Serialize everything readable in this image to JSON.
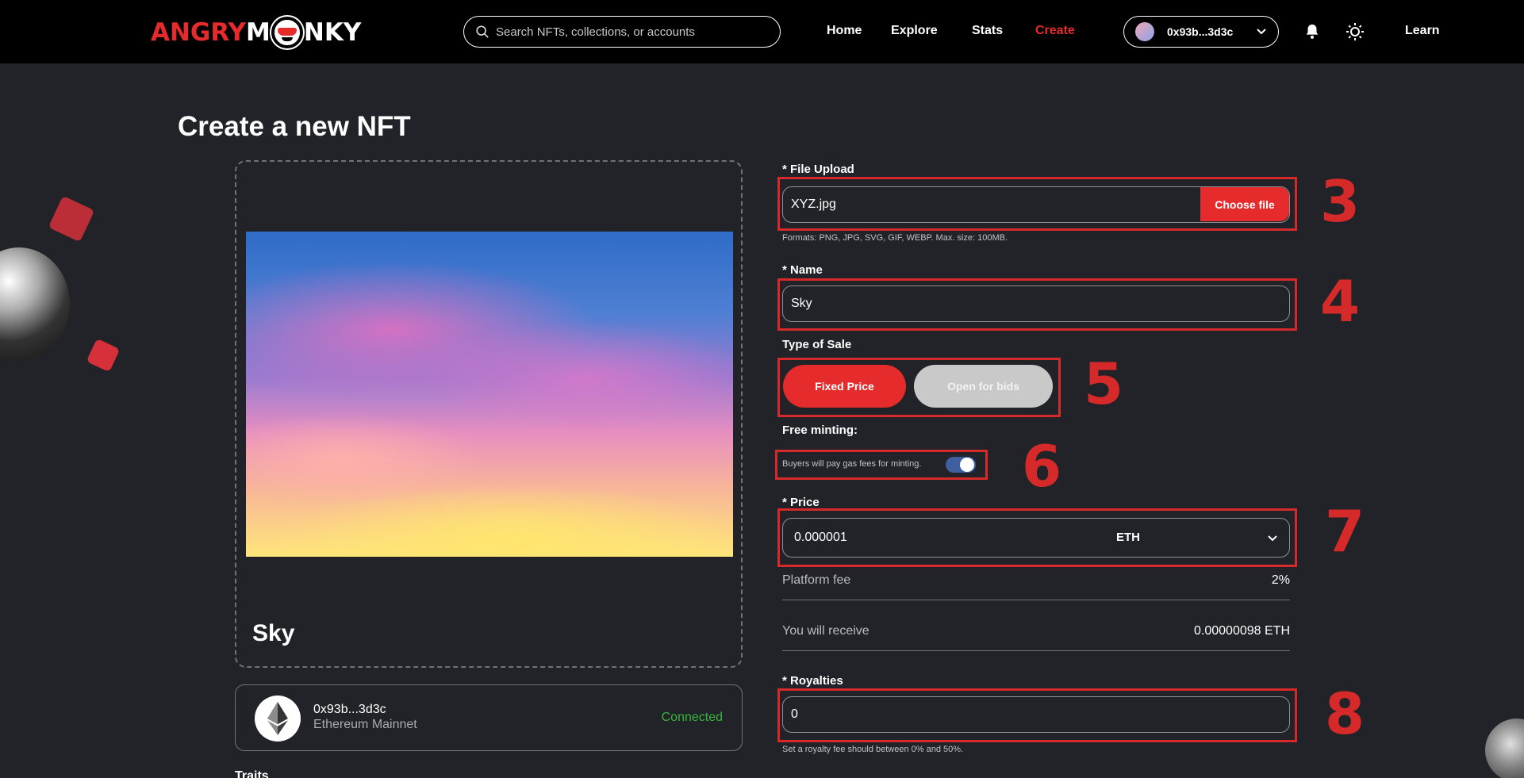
{
  "header": {
    "logo_prefix": "ANGRY",
    "logo_suffix": "NKY",
    "search_placeholder": "Search NFTs, collections, or accounts",
    "nav": [
      {
        "label": "Home"
      },
      {
        "label": "Explore"
      },
      {
        "label": "Stats"
      },
      {
        "label": "Create"
      }
    ],
    "wallet_address": "0x93b...3d3c",
    "learn_label": "Learn"
  },
  "page_title": "Create a new NFT",
  "preview": {
    "name": "Sky",
    "wallet_address": "0x93b...3d3c",
    "network": "Ethereum Mainnet",
    "status": "Connected"
  },
  "traits_label": "Traits",
  "form": {
    "file_label": "* File Upload",
    "file_value": "XYZ.jpg",
    "choose_file": "Choose file",
    "file_hint": "Formats: PNG, JPG, SVG, GIF, WEBP. Max. size: 100MB.",
    "name_label": "* Name",
    "name_value": "Sky",
    "sale_label": "Type of Sale",
    "sale_fixed": "Fixed Price",
    "sale_bids": "Open for bids",
    "free_minting_label": "Free minting:",
    "free_minting_text": "Buyers will pay gas fees for minting.",
    "free_minting_on": true,
    "price_label": "* Price",
    "price_value": "0.000001",
    "currency": "ETH",
    "platform_fee_label": "Platform fee",
    "platform_fee_value": "2%",
    "receive_label": "You will receive",
    "receive_value": "0.00000098 ETH",
    "royalties_label": "* Royalties",
    "royalties_value": "0",
    "royalties_hint": "Set a royalty fee should between 0% and 50%."
  },
  "annotations": [
    "3",
    "4",
    "5",
    "6",
    "7",
    "8"
  ],
  "colors": {
    "accent": "#e52b2b",
    "annotation": "#d62a2a",
    "background": "#212328",
    "header": "#000000",
    "connected": "#38b53b"
  }
}
